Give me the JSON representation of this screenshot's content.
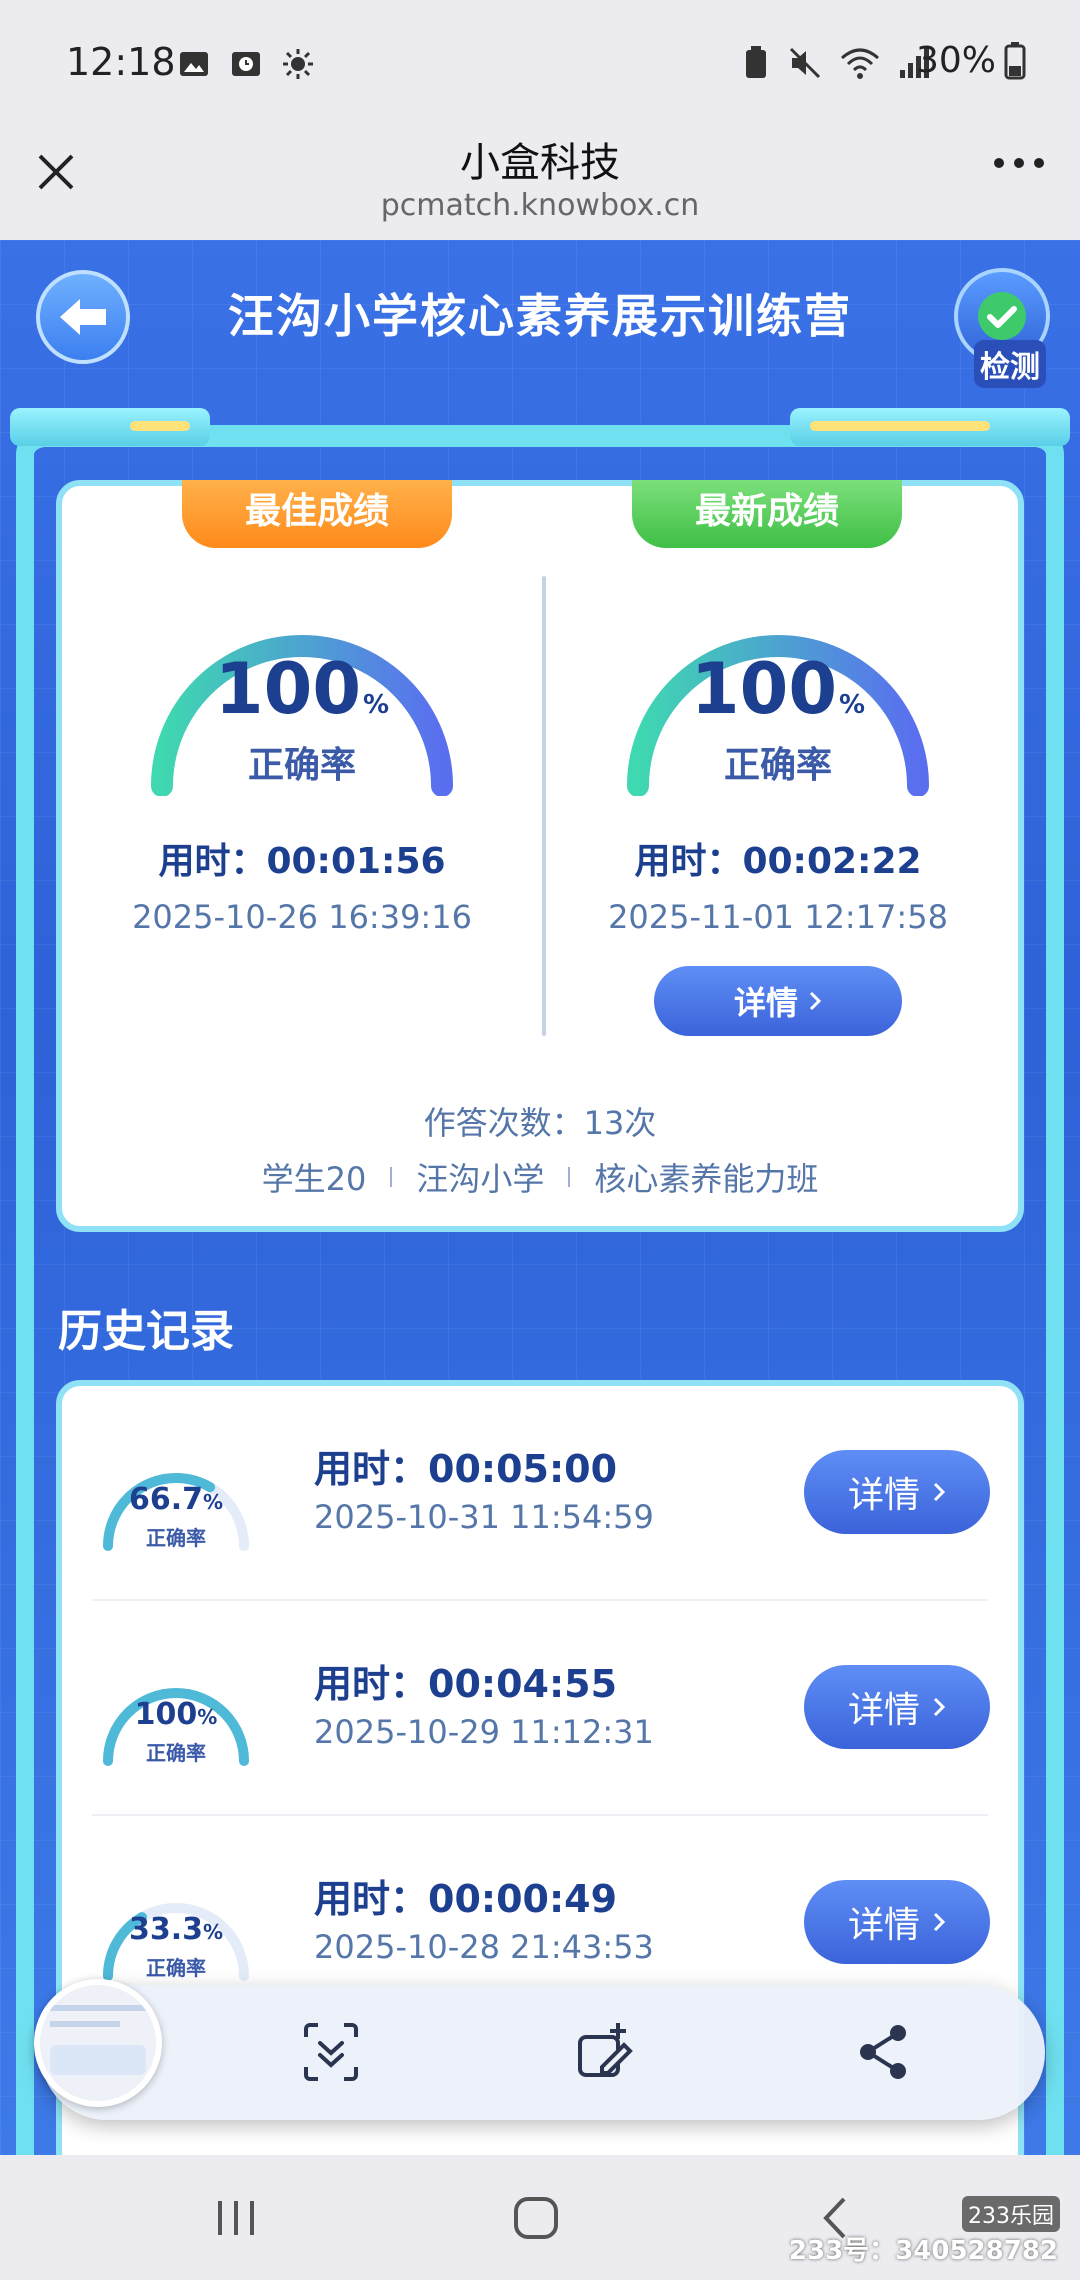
{
  "status_bar": {
    "time": "12:18",
    "battery": "30%"
  },
  "webview": {
    "title": "小盒科技",
    "url": "pcmatch.knowbox.cn"
  },
  "page": {
    "title": "汪沟小学核心素养展示训练营",
    "check_label": "检测"
  },
  "score": {
    "best": {
      "tag": "最佳成绩",
      "value": "100",
      "pct_sign": "%",
      "accuracy_label": "正确率",
      "time": "用时：00:01:56",
      "date": "2025-10-26 16:39:16",
      "ratio": 1.0
    },
    "latest": {
      "tag": "最新成绩",
      "value": "100",
      "pct_sign": "%",
      "accuracy_label": "正确率",
      "time": "用时：00:02:22",
      "date": "2025-11-01 12:17:58",
      "ratio": 1.0,
      "detail_label": "详情"
    },
    "attempts": "作答次数：13次",
    "student": "学生20",
    "school": "汪沟小学",
    "class": "核心素养能力班"
  },
  "history": {
    "title": "历史记录",
    "items": [
      {
        "accuracy": "66.7",
        "pct_sign": "%",
        "accuracy_label": "正确率",
        "time": "用时：00:05:00",
        "date": "2025-10-31 11:54:59",
        "detail_label": "详情",
        "ratio": 0.667
      },
      {
        "accuracy": "100",
        "pct_sign": "%",
        "accuracy_label": "正确率",
        "time": "用时：00:04:55",
        "date": "2025-10-29 11:12:31",
        "detail_label": "详情",
        "ratio": 1.0
      },
      {
        "accuracy": "33.3",
        "pct_sign": "%",
        "accuracy_label": "正确率",
        "time": "用时：00:00:49",
        "date": "2025-10-28 21:43:53",
        "detail_label": "详情",
        "ratio": 0.333
      }
    ]
  },
  "watermark": {
    "logo": "233乐园",
    "text": "233号：340528782"
  },
  "colors": {
    "accent": "#3b63da",
    "gauge_start": "#3fd8b0",
    "gauge_end": "#5a6ef0",
    "best_tag": "#ff8a1a",
    "latest_tag": "#3fbf45"
  },
  "icons": [
    "close-icon",
    "more-icon",
    "back-arrow-icon",
    "check-icon",
    "scroll-capture-icon",
    "edit-crop-icon",
    "share-icon",
    "recents-icon",
    "home-icon",
    "back-icon"
  ]
}
